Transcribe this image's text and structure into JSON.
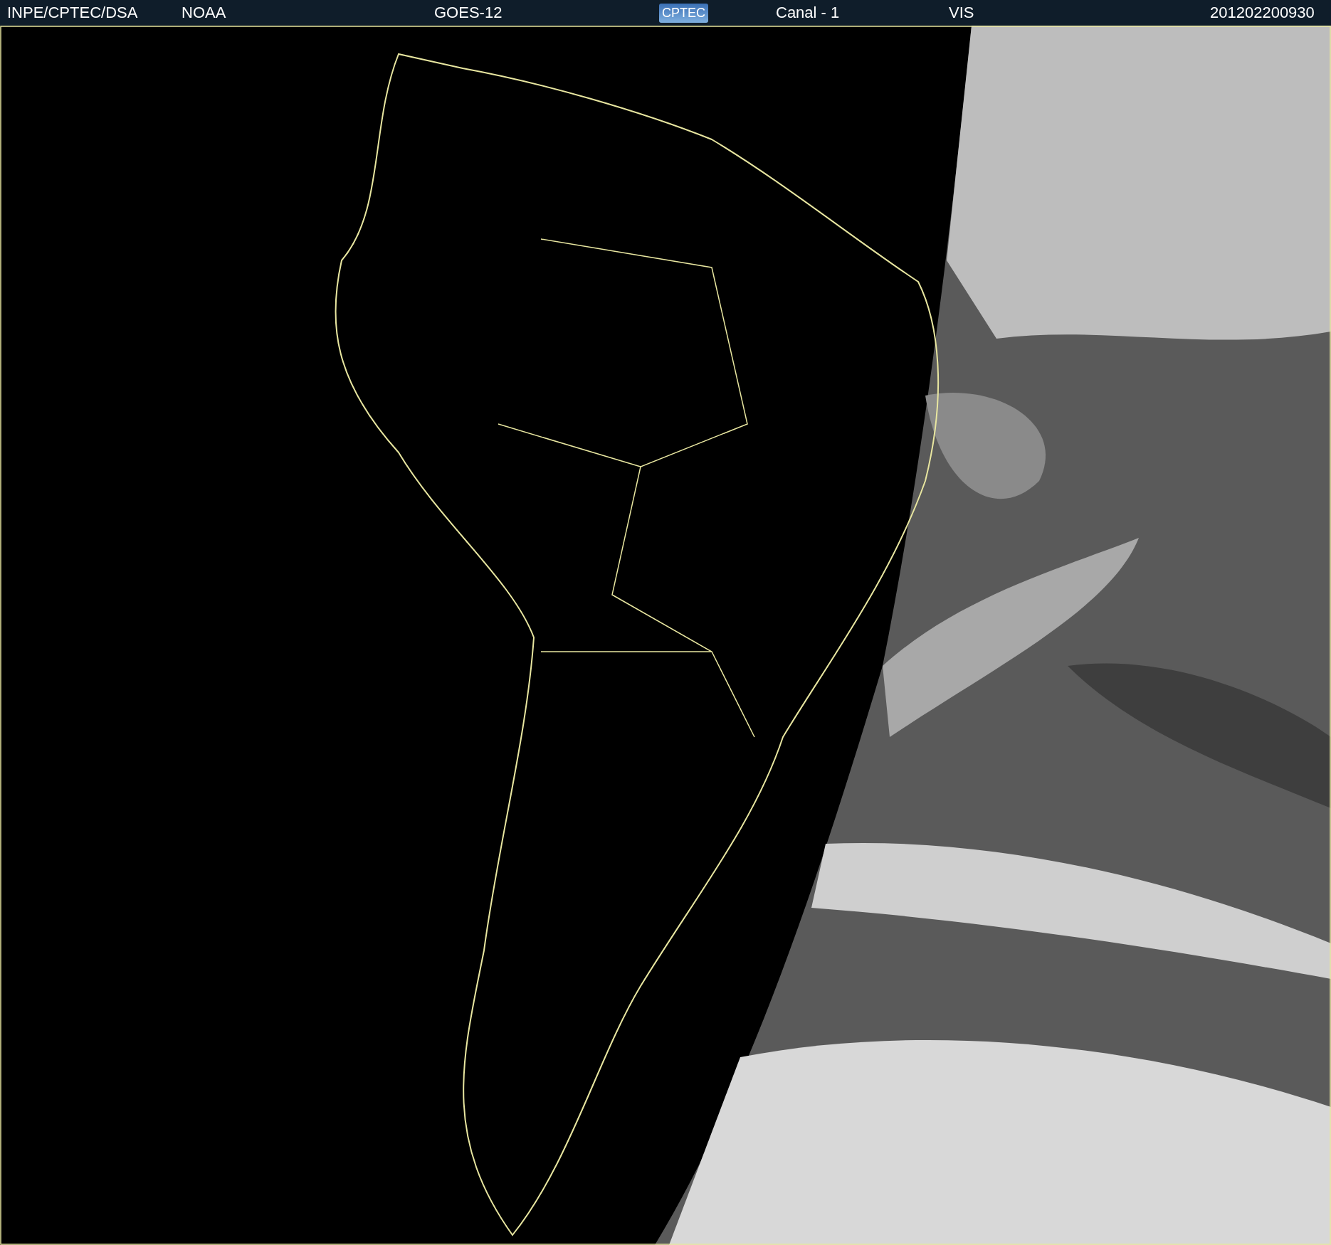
{
  "header": {
    "source": "INPE/CPTEC/DSA",
    "agency": "NOAA",
    "satellite": "GOES-12",
    "logo": "CPTEC",
    "channel": "Canal - 1",
    "band": "VIS",
    "timestamp": "201202200930"
  }
}
